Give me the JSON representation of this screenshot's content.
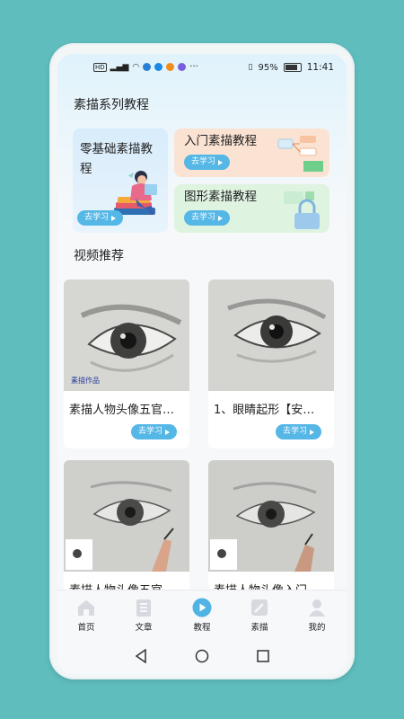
{
  "status_bar": {
    "left_icons": [
      "HD",
      "signal-4g-icon",
      "wifi-icon",
      "app-icons"
    ],
    "ellipsis": "···",
    "battery": "95%",
    "time": "11:41"
  },
  "series": {
    "section_title": "素描系列教程",
    "cards": [
      {
        "title": "零基础素描教程",
        "button": "去学习"
      },
      {
        "title": "入门素描教程",
        "button": "去学习"
      },
      {
        "title": "图形素描教程",
        "button": "去学习"
      }
    ]
  },
  "videos": {
    "section_title": "视频推荐",
    "items": [
      {
        "title": "素描人物头像五官…",
        "button": "去学习",
        "watermark": "素描作品"
      },
      {
        "title": "1、眼睛起形【安…",
        "button": "去学习"
      },
      {
        "title": "素描人物头像五官",
        "button": ""
      },
      {
        "title": "素描人物头像入门",
        "button": ""
      }
    ]
  },
  "tabbar": {
    "tabs": [
      {
        "label": "首页",
        "icon": "home-icon"
      },
      {
        "label": "文章",
        "icon": "article-icon"
      },
      {
        "label": "教程",
        "icon": "play-icon",
        "active": true
      },
      {
        "label": "素描",
        "icon": "pencil-icon"
      },
      {
        "label": "我的",
        "icon": "profile-icon"
      }
    ]
  },
  "colors": {
    "accent": "#55b7e6",
    "background": "#5fbdbd",
    "card_orange": "#fbe3d3",
    "card_green": "#dff3e1",
    "card_blue": "#d8ecfb"
  }
}
